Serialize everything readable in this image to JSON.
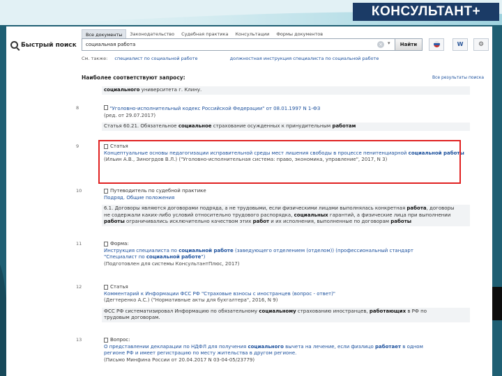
{
  "brand": {
    "logo_text": "КОНСУЛЬТАНТ+"
  },
  "quick_search": {
    "label": "Быстрый поиск"
  },
  "tabs": [
    {
      "label": "Все документы",
      "active": true
    },
    {
      "label": "Законодательство",
      "active": false
    },
    {
      "label": "Судебная практика",
      "active": false
    },
    {
      "label": "Консультации",
      "active": false
    },
    {
      "label": "Формы документов",
      "active": false
    }
  ],
  "search": {
    "value": "социальная работа",
    "clear_glyph": "×",
    "dropdown_glyph": "▾",
    "find_label": "Найти"
  },
  "toolbar": {
    "word_glyph": "W",
    "settings_glyph": "⚙"
  },
  "see_also": {
    "label": "См. также:",
    "links": [
      "специалист по социальной работе",
      "должностная инструкция специалиста по социальной работе"
    ]
  },
  "best_match": {
    "heading": "Наиболее соответствуют запросу:",
    "all_results": "Все результаты поиска"
  },
  "results": {
    "r7": {
      "snippet_bold": "социального",
      "snippet_rest": " университета г. Клину."
    },
    "r8": {
      "num": "8",
      "title": "\"Уголовно-исполнительный кодекс Российской Федерации\" от 08.01.1997 N 1-ФЗ",
      "meta": "(ред. от 29.07.2017)",
      "snippet_a": "Статья 60.21. Обязательное ",
      "snippet_b1": "социальное",
      "snippet_c": " страхование осужденных к принудительным ",
      "snippet_b2": "работам"
    },
    "r9": {
      "num": "9",
      "type": "Статья",
      "title_a": "Концептуальные основы педагогизации исправительной среды мест лишения свободы в процессе пенитенциарной ",
      "title_b": "социальной работы",
      "meta": "(Ильин А.В., Зиногрдов В.Л.) (\"Уголовно-исполнительная система: право, экономика, управление\", 2017, N 3)"
    },
    "r10": {
      "num": "10",
      "type": "Путеводитель по судебной практике",
      "title": "Подряд. Общие положения",
      "line1_a": "6.1. Договоры являются договорами подряда, а не трудовыми, если физическими лицами выполнялась конкретная ",
      "line1_b": "работа",
      "line1_c": ", договоры",
      "line2_a": "не содержали каких-либо условий относительно трудового распорядка, ",
      "line2_b": "социальных",
      "line2_c": " гарантий, а физические лица при выполнении",
      "line3_a": "работы",
      "line3_b": " ограничивались исключительно качеством этих ",
      "line3_c": "работ",
      "line3_d": " и их исполнения, выполненные по договорам ",
      "line3_e": "работы"
    },
    "r11": {
      "num": "11",
      "type": "Форма:",
      "title_a": "Инструкция специалиста по ",
      "title_b": "социальной работе",
      "title_c": " (заведующего отделением (отделом)) (профессиональный стандарт",
      "title_d": "\"Специалист по ",
      "title_e": "социальной работе",
      "title_f": "\")",
      "meta": "(Подготовлен для системы КонсультантПлюс, 2017)"
    },
    "r12": {
      "num": "12",
      "type": "Статья",
      "title": "Комментарий к Информации ФСС РФ \"Страховые взносы с иностранцев (вопрос - ответ)\"",
      "meta": "(Дегтеренко А.С.) (\"Нормативные акты для бухгалтера\", 2016, N 9)",
      "snippet_a": "ФСС РФ систематизировал Информацию по обязательному ",
      "snippet_b": "социальному",
      "snippet_c": " страхованию иностранцев, ",
      "snippet_d": "работающих",
      "snippet_e": " в РФ по",
      "snippet_f": "трудовым договорам."
    },
    "r13": {
      "num": "13",
      "type": "Вопрос:",
      "title_a": "О представлении декларации по НДФЛ для получения ",
      "title_b": "социального",
      "title_c": " вычета на лечение, если физлицо ",
      "title_d": "работает",
      "title_e": " в одном",
      "title_f": "регионе РФ и имеет регистрацию по месту жительства в другом регионе.",
      "meta": "(Письмо Минфина России от 20.04.2017 N 03-04-05/23779)"
    }
  }
}
